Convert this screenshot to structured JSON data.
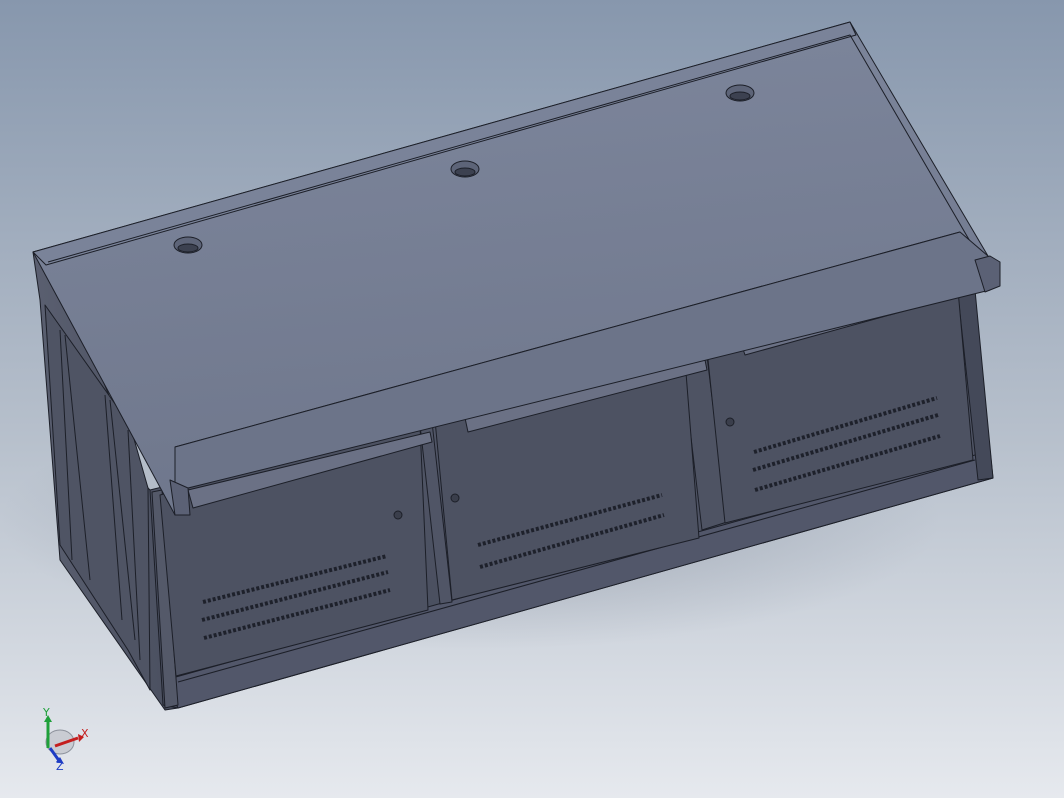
{
  "viewport": {
    "model": "operator-console-cabinet",
    "colors": {
      "background_top": "#8797ad",
      "background_mid": "#b7c0cc",
      "background_bottom": "#e6e9ee",
      "body_dark": "#4b5061",
      "body_mid": "#5c6172",
      "top_surface": "#77809a",
      "edge_line": "#1c1f28",
      "vent_slot": "#1e212b"
    }
  },
  "triad": {
    "x_label": "X",
    "y_label": "Y",
    "z_label": "Z",
    "x_color": "#c41e1e",
    "y_color": "#1ea03a",
    "z_color": "#1e3cc4"
  }
}
